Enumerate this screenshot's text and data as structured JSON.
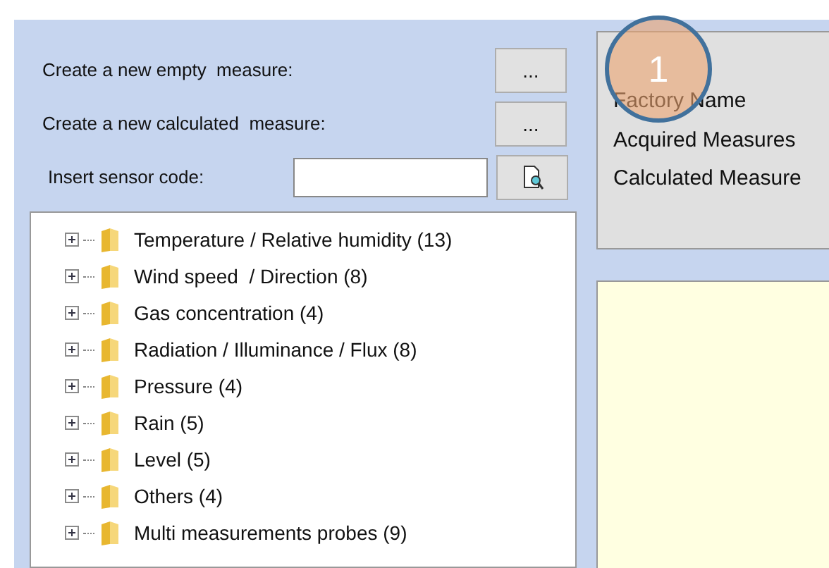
{
  "actions": [
    {
      "kind": "button",
      "label": "Create a new empty  measure:",
      "button": "..."
    },
    {
      "kind": "button",
      "label": "Create a new calculated  measure:",
      "button": "..."
    },
    {
      "kind": "search",
      "label": "Insert sensor code:"
    }
  ],
  "tree": [
    {
      "label": "Temperature / Relative humidity (13)",
      "expanded": false
    },
    {
      "label": "Wind speed  / Direction (8)",
      "expanded": false
    },
    {
      "label": "Gas concentration (4)",
      "expanded": false
    },
    {
      "label": "Radiation / Illuminance / Flux (8)",
      "expanded": false
    },
    {
      "label": "Pressure (4)",
      "expanded": false
    },
    {
      "label": "Rain (5)",
      "expanded": false
    },
    {
      "label": "Level (5)",
      "expanded": false
    },
    {
      "label": "Others (4)",
      "expanded": false
    },
    {
      "label": "Multi measurements probes (9)",
      "expanded": false
    }
  ],
  "info": [
    "Factory Name",
    "Acquired Measures",
    "Calculated Measure"
  ],
  "callout": "1"
}
